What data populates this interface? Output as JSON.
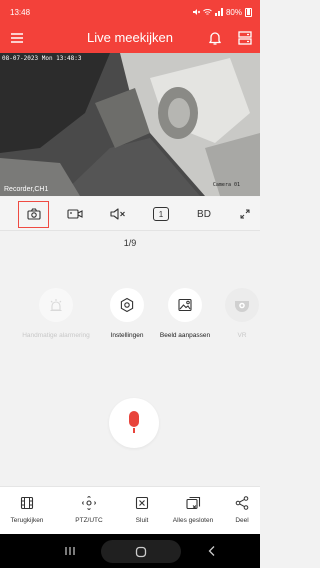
{
  "status": {
    "time": "13:48",
    "battery": "80%"
  },
  "header": {
    "title": "Live meekijken",
    "menu_icon": "menu-icon",
    "bell_icon": "bell-icon",
    "layout_icon": "layout-icon",
    "color": "#f3413a"
  },
  "video": {
    "timestamp": "08-07-2023 Mon 13:48:3",
    "camera_label": "Camera 01",
    "recorder_label": "Recorder,CH1"
  },
  "toolbar": {
    "stream_number": "1",
    "quality": "BD"
  },
  "page_indicator": "1/9",
  "actions": [
    {
      "label": "Handmatige alarmering",
      "icon": "alarm-light-icon",
      "enabled": false
    },
    {
      "label": "Instellingen",
      "icon": "settings-icon",
      "enabled": true
    },
    {
      "label": "Beeld aanpassen",
      "icon": "image-adjust-icon",
      "enabled": true
    },
    {
      "label": "VR",
      "icon": "vr-camera-icon",
      "enabled": false
    }
  ],
  "bottom_nav": [
    {
      "label": "Terugkijken",
      "icon": "playback-icon"
    },
    {
      "label": "PTZ/UTC",
      "icon": "ptz-icon"
    },
    {
      "label": "Sluit",
      "icon": "close-box-icon"
    },
    {
      "label": "Alles gesloten",
      "icon": "close-all-icon"
    },
    {
      "label": "Deel",
      "icon": "share-icon"
    }
  ],
  "colors": {
    "accent": "#f3413a",
    "mic": "#e8443c"
  }
}
